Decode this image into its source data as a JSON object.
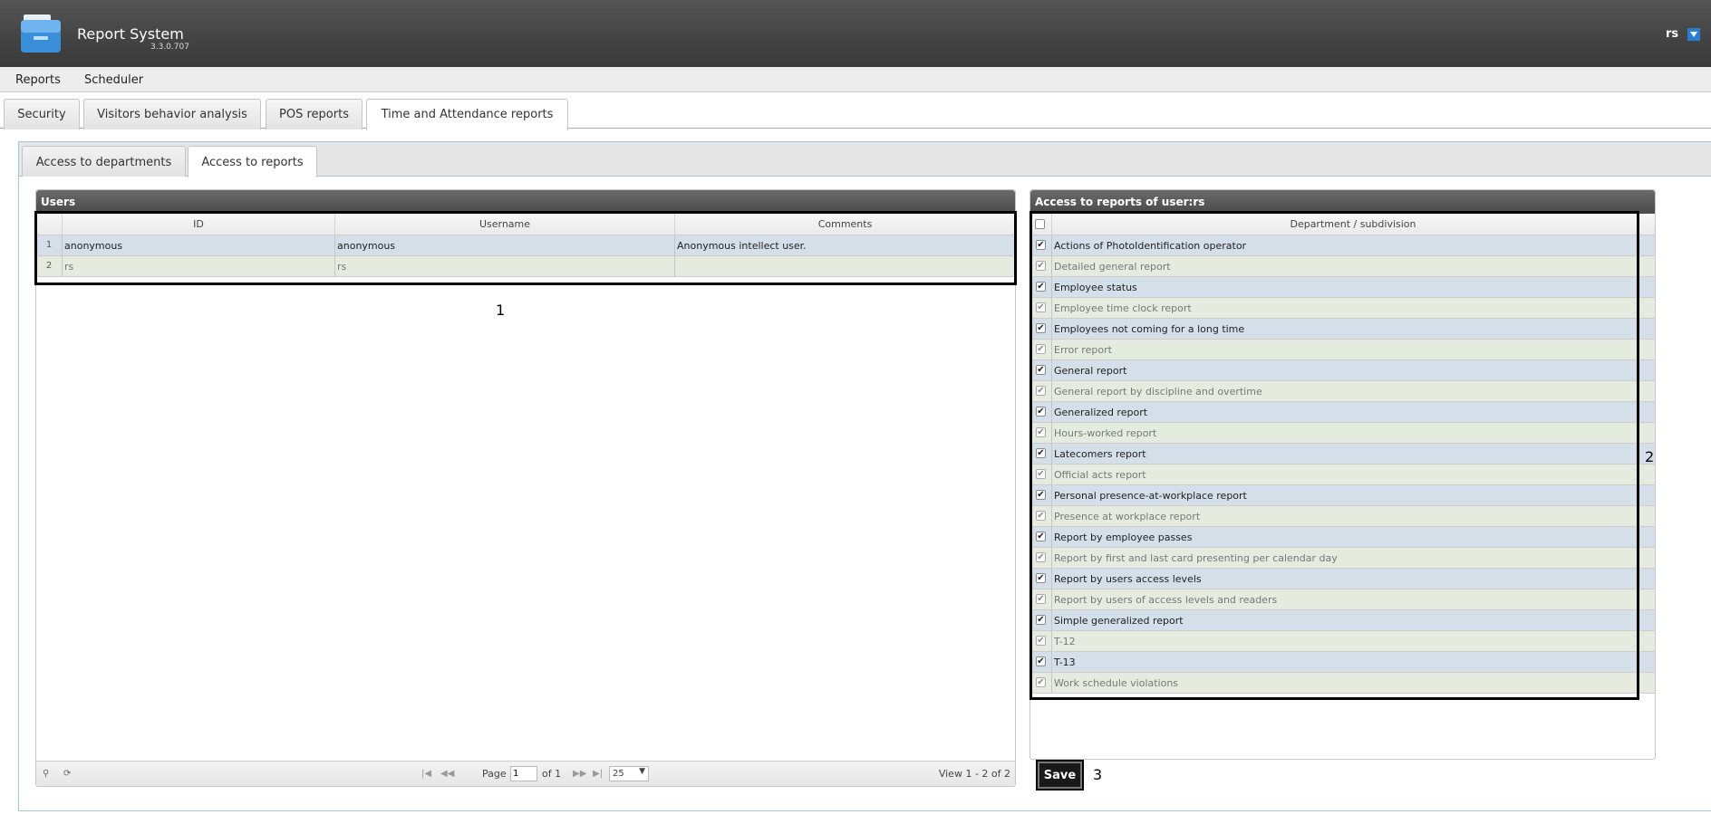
{
  "header": {
    "app_title": "Report System",
    "app_version": "3.3.0.707",
    "user_name": "rs"
  },
  "menu": {
    "items": [
      "Reports",
      "Scheduler"
    ]
  },
  "top_tabs": [
    "Security",
    "Visitors behavior analysis",
    "POS reports",
    "Time and Attendance reports"
  ],
  "sub_tabs": [
    "Access to departments",
    "Access to reports"
  ],
  "users_panel": {
    "title": "Users",
    "columns": [
      "ID",
      "Username",
      "Comments"
    ],
    "rows": [
      {
        "num": "1",
        "id": "anonymous",
        "username": "anonymous",
        "comments": "Anonymous intellect user."
      },
      {
        "num": "2",
        "id": "rs",
        "username": "rs",
        "comments": ""
      }
    ],
    "pager": {
      "page_label": "Page",
      "page_value": "1",
      "of_label": "of 1",
      "rows_per_page": "25",
      "view_text": "View 1 - 2 of 2"
    }
  },
  "access_panel": {
    "title": "Access to reports of user:rs",
    "column": "Department / subdivision",
    "reports": [
      "Actions of PhotoIdentification operator",
      "Detailed general report",
      "Employee status",
      "Employee time clock report",
      "Employees not coming for a long time",
      "Error report",
      "General report",
      "General report by discipline and overtime",
      "Generalized report",
      "Hours-worked report",
      "Latecomers report",
      "Official acts report",
      "Personal presence-at-workplace report",
      "Presence at workplace report",
      "Report by employee passes",
      "Report by first and last card presenting per calendar day",
      "Report by users access levels",
      "Report by users of access levels and readers",
      "Simple generalized report",
      "T-12",
      "T-13",
      "Work schedule violations"
    ]
  },
  "save_label": "Save",
  "callouts": [
    "1",
    "2",
    "3"
  ]
}
